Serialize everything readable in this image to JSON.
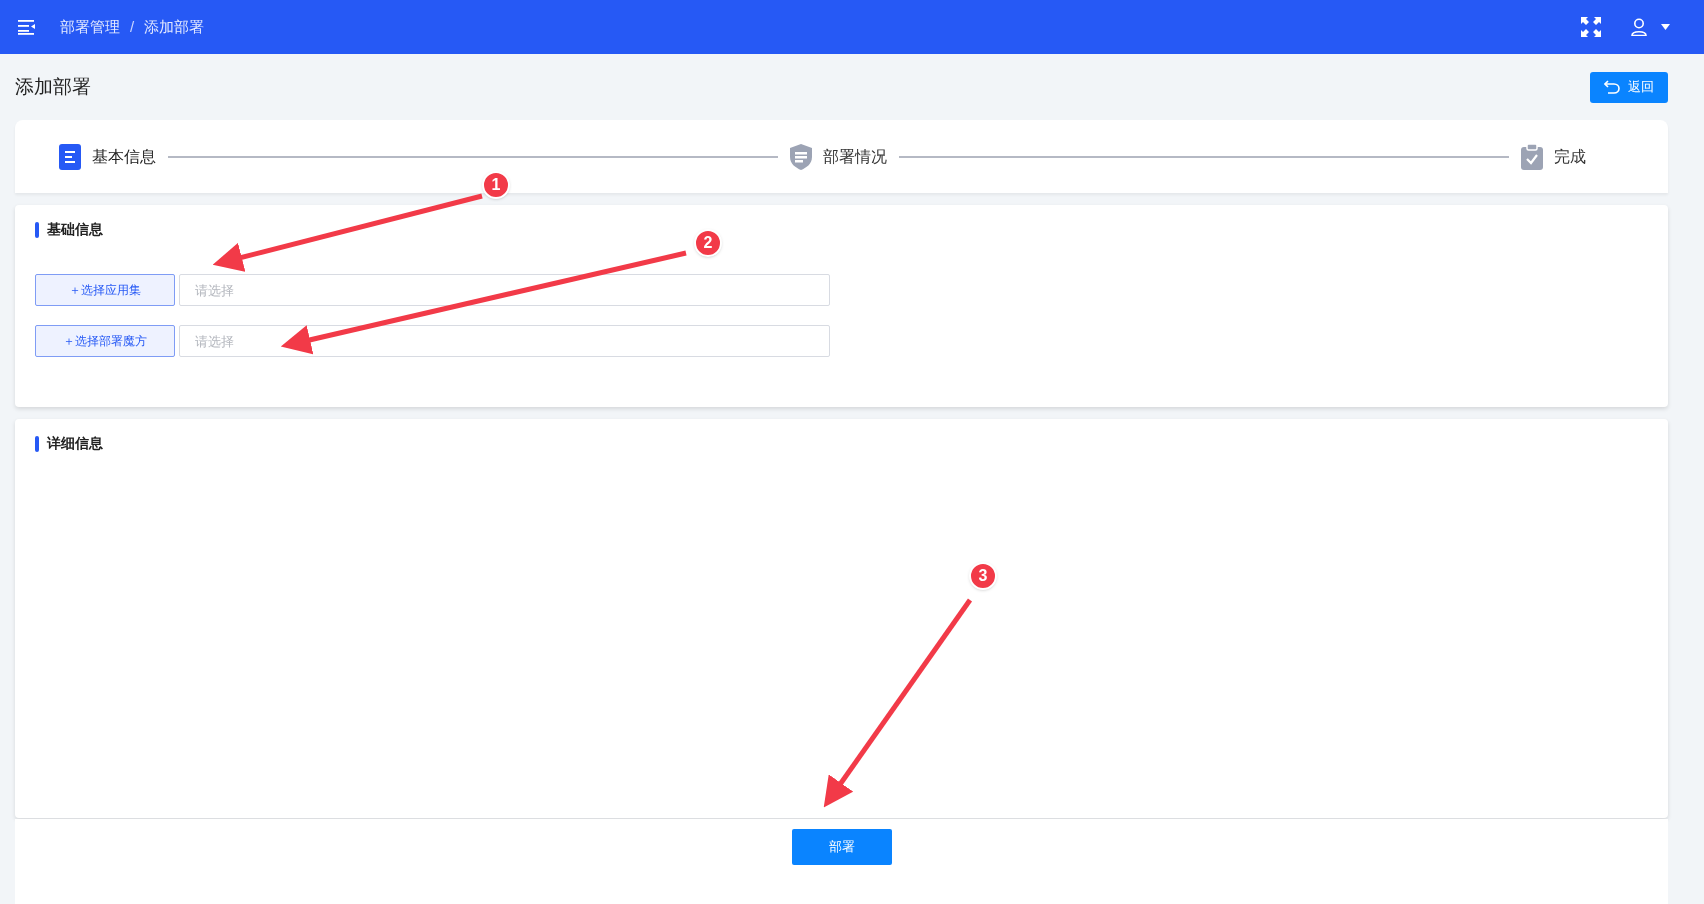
{
  "header": {
    "breadcrumb": [
      "部署管理",
      "添加部署"
    ],
    "separator": "/"
  },
  "page": {
    "title": "添加部署",
    "back_button": "返回"
  },
  "steps": [
    {
      "label": "基本信息",
      "active": true
    },
    {
      "label": "部署情况",
      "active": false
    },
    {
      "label": "完成",
      "active": false
    }
  ],
  "basic_section": {
    "title": "基础信息",
    "rows": [
      {
        "button": "＋选择应用集",
        "placeholder": "请选择"
      },
      {
        "button": "＋选择部署魔方",
        "placeholder": "请选择"
      }
    ]
  },
  "detail_section": {
    "title": "详细信息"
  },
  "submit_button": "部署",
  "annotations": [
    {
      "label": "1"
    },
    {
      "label": "2"
    },
    {
      "label": "3"
    }
  ]
}
